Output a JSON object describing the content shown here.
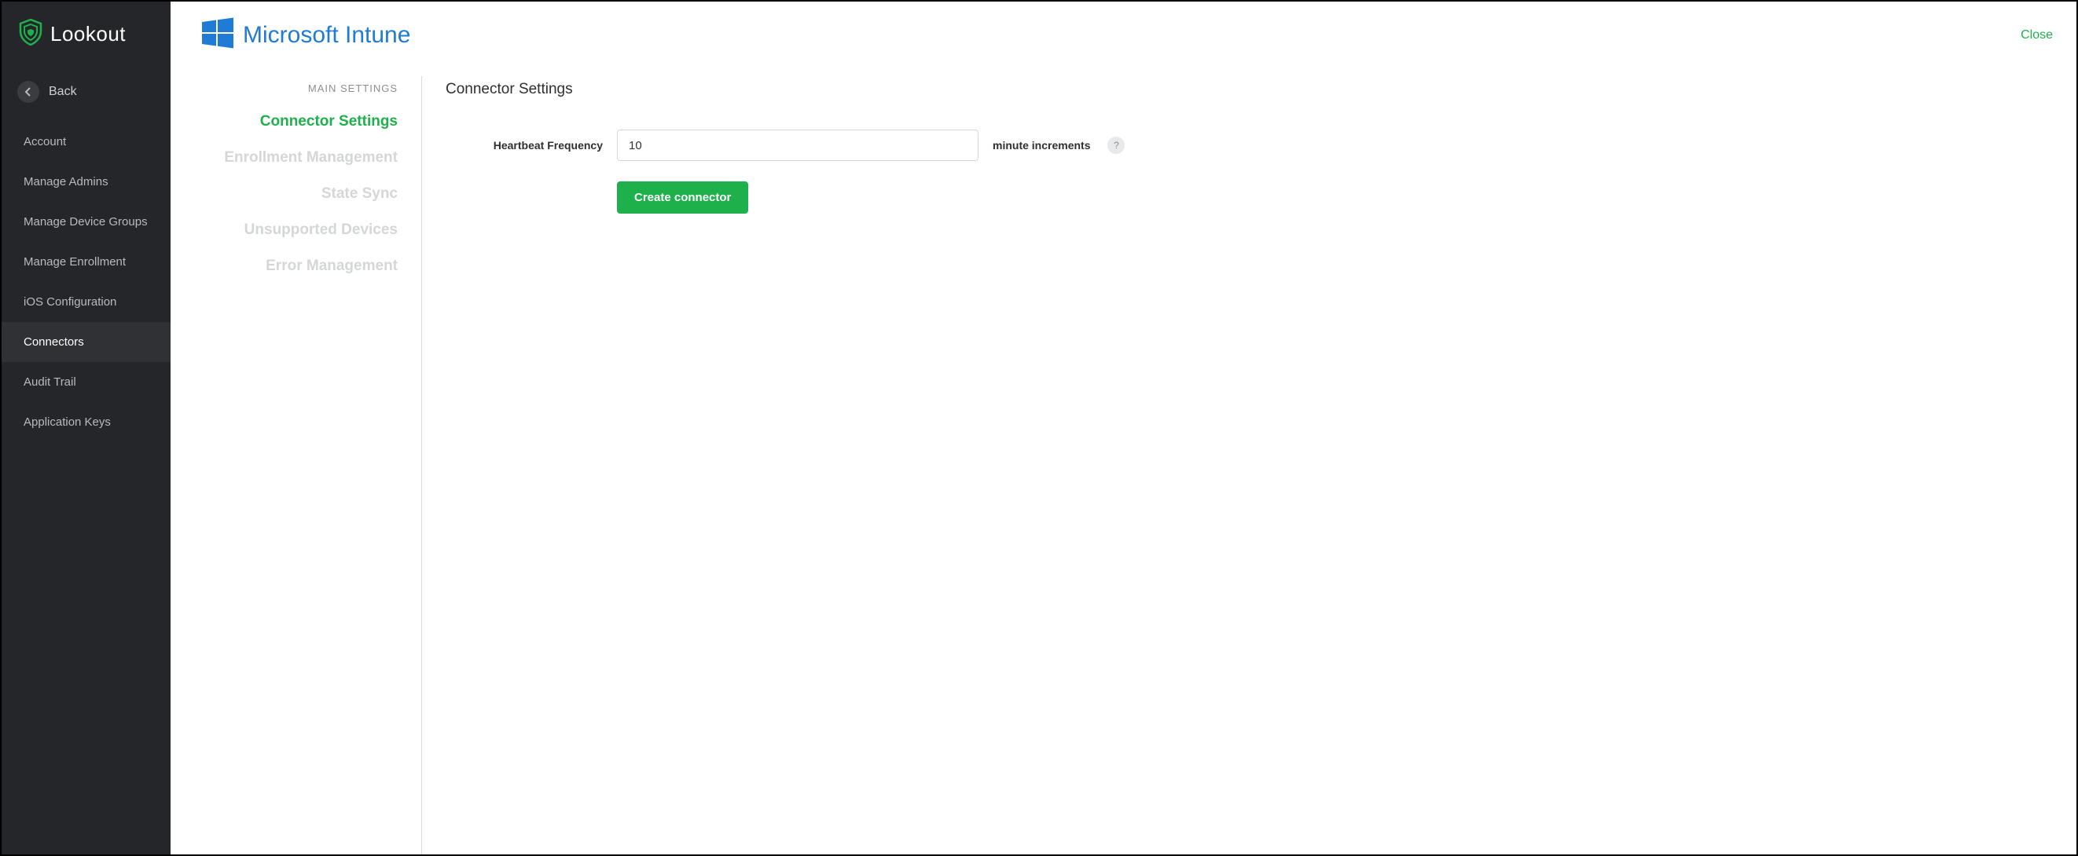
{
  "brand": {
    "name": "Lookout"
  },
  "sidebar": {
    "back_label": "Back",
    "items": [
      {
        "label": "Account",
        "active": false
      },
      {
        "label": "Manage Admins",
        "active": false
      },
      {
        "label": "Manage Device Groups",
        "active": false
      },
      {
        "label": "Manage Enrollment",
        "active": false
      },
      {
        "label": "iOS Configuration",
        "active": false
      },
      {
        "label": "Connectors",
        "active": true
      },
      {
        "label": "Audit Trail",
        "active": false
      },
      {
        "label": "Application Keys",
        "active": false
      }
    ]
  },
  "header": {
    "product_name": "Microsoft Intune",
    "close_label": "Close"
  },
  "settings_nav": {
    "heading": "MAIN SETTINGS",
    "items": [
      {
        "label": "Connector Settings",
        "active": true
      },
      {
        "label": "Enrollment Management",
        "active": false
      },
      {
        "label": "State Sync",
        "active": false
      },
      {
        "label": "Unsupported Devices",
        "active": false
      },
      {
        "label": "Error Management",
        "active": false
      }
    ]
  },
  "panel": {
    "title": "Connector Settings",
    "heartbeat_label": "Heartbeat Frequency",
    "heartbeat_value": "10",
    "heartbeat_suffix": "minute increments",
    "help_symbol": "?",
    "create_button": "Create connector"
  },
  "colors": {
    "accent_green": "#1eb14b",
    "intune_blue": "#1f7bd6",
    "sidebar_bg": "#24262a"
  }
}
